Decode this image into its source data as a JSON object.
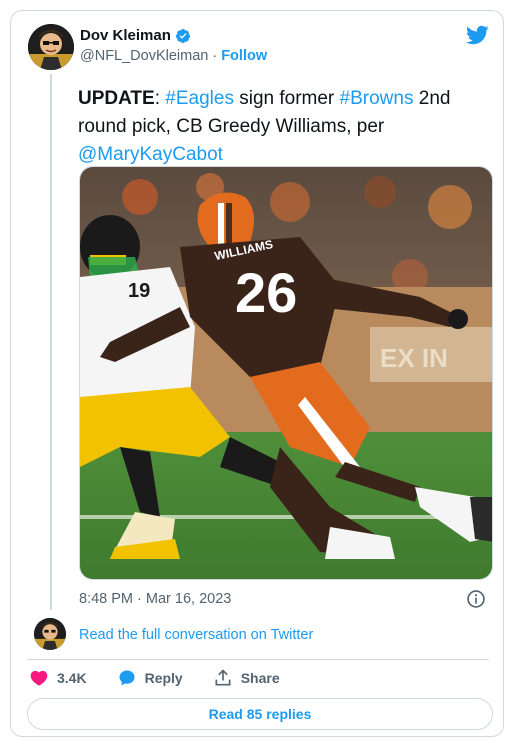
{
  "author": {
    "display_name": "Dov Kleiman",
    "handle": "@NFL_DovKleiman",
    "separator": "·",
    "follow_label": "Follow"
  },
  "tweet": {
    "update_word": "UPDATE",
    "after_update": ": ",
    "tag_eagles": "#Eagles",
    "text_sign": " sign former ",
    "tag_browns": "#Browns",
    "text_rest": " 2nd round pick, CB Greedy Williams, per ",
    "mention": "@MaryKayCabot",
    "photo_jersey_number": "26",
    "photo_jersey_name": "WILLIAMS",
    "timestamp": "8:48 PM · Mar 16, 2023"
  },
  "conversation": {
    "read_full_label": "Read the full conversation on Twitter"
  },
  "actions": {
    "like_count": "3.4K",
    "reply_label": "Reply",
    "share_label": "Share",
    "read_replies_label": "Read 85 replies"
  },
  "colors": {
    "accent": "#1d9bf0",
    "like": "#f91880",
    "text": "#0f1419",
    "secondary": "#536471",
    "border": "#cfd9de"
  }
}
